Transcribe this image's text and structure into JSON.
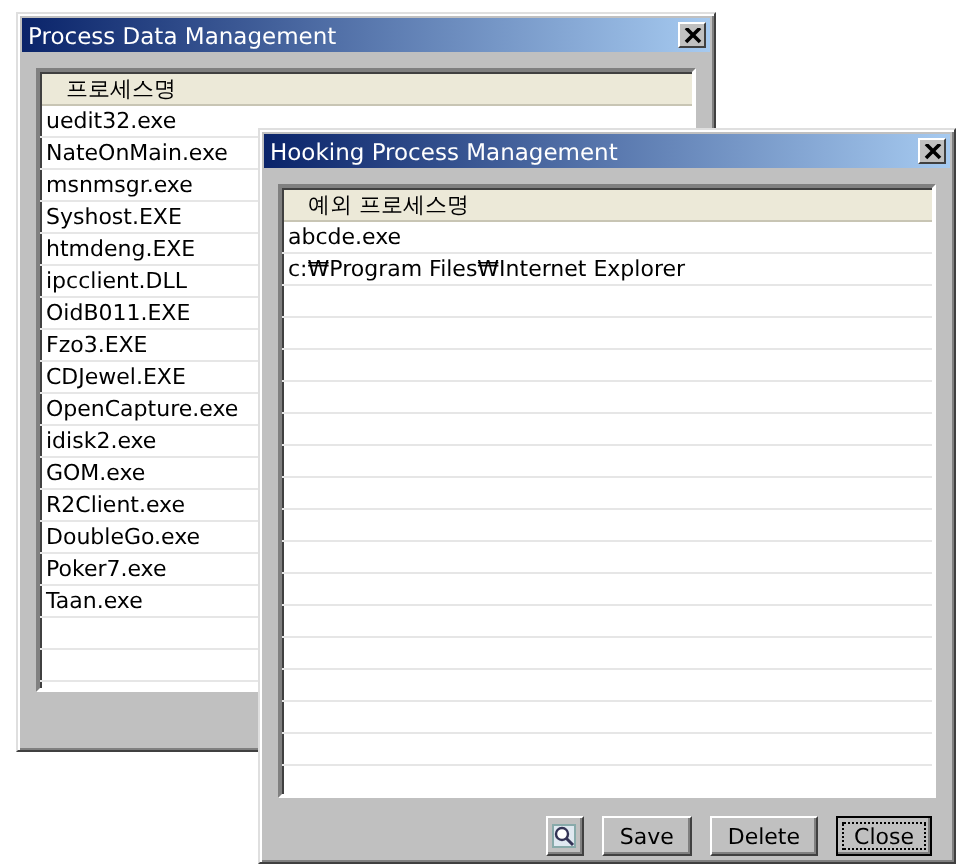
{
  "windows": [
    {
      "title": "Process Data Management",
      "list": {
        "column": "프로세스명",
        "rows": [
          "uedit32.exe",
          "NateOnMain.exe",
          "msnmsgr.exe",
          "Syshost.EXE",
          "htmdeng.EXE",
          "ipcclient.DLL",
          "OidB011.EXE",
          "Fzo3.EXE",
          "CDJewel.EXE",
          "OpenCapture.exe",
          "idisk2.exe",
          "GOM.exe",
          "R2Client.exe",
          "DoubleGo.exe",
          "Poker7.exe",
          "Taan.exe"
        ]
      }
    },
    {
      "title": "Hooking Process Management",
      "list": {
        "column": "예외 프로세스명",
        "rows": [
          "abcde.exe",
          "c:₩Program Files₩Internet Explorer"
        ]
      },
      "buttons": [
        {
          "kind": "icon",
          "focused": false
        },
        {
          "kind": "text",
          "label": "Save",
          "focused": false
        },
        {
          "kind": "text",
          "label": "Delete",
          "focused": false
        },
        {
          "kind": "text",
          "label": "Close",
          "focused": true
        }
      ]
    }
  ]
}
